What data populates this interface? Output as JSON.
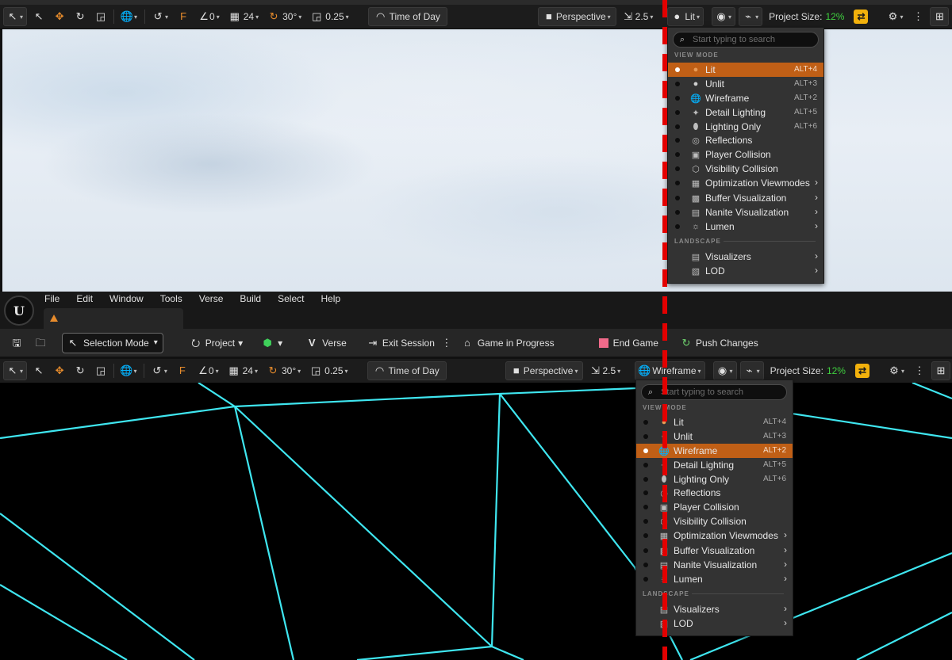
{
  "top_toolbar": {
    "snap_rotate": "0",
    "grid_size": "24",
    "rotate_snap": "30°",
    "scale_snap": "0.25",
    "time_of_day": "Time of Day",
    "perspective": "Perspective",
    "camera_speed": "2.5",
    "view_mode": "Lit",
    "project_size_label": "Project Size:",
    "project_size_value": "12%"
  },
  "bottom_toolbar": {
    "snap_rotate": "0",
    "grid_size": "24",
    "rotate_snap": "30°",
    "scale_snap": "0.25",
    "time_of_day": "Time of Day",
    "perspective": "Perspective",
    "camera_speed": "2.5",
    "view_mode": "Wireframe",
    "project_size_label": "Project Size:",
    "project_size_value": "12%"
  },
  "menu_bar": [
    "File",
    "Edit",
    "Window",
    "Tools",
    "Verse",
    "Build",
    "Select",
    "Help"
  ],
  "main_toolbar": {
    "selection_mode": "Selection Mode",
    "project": "Project",
    "verse": "Verse",
    "exit_session": "Exit Session",
    "game_in_progress": "Game in Progress",
    "end_game": "End Game",
    "push_changes": "Push Changes"
  },
  "view_menu": {
    "search_placeholder": "Start typing to search",
    "section_view_mode": "VIEW MODE",
    "section_landscape": "LANDSCAPE",
    "items": [
      {
        "label": "Lit",
        "shortcut": "ALT+4",
        "icon": "lit-sphere-icon"
      },
      {
        "label": "Unlit",
        "shortcut": "ALT+3",
        "icon": "unlit-sphere-icon"
      },
      {
        "label": "Wireframe",
        "shortcut": "ALT+2",
        "icon": "wireframe-globe-icon"
      },
      {
        "label": "Detail Lighting",
        "shortcut": "ALT+5",
        "icon": "detail-lighting-icon"
      },
      {
        "label": "Lighting Only",
        "shortcut": "ALT+6",
        "icon": "bulb-icon"
      },
      {
        "label": "Reflections",
        "shortcut": "",
        "icon": "reflections-icon"
      },
      {
        "label": "Player Collision",
        "shortcut": "",
        "icon": "player-collision-icon"
      },
      {
        "label": "Visibility Collision",
        "shortcut": "",
        "icon": "visibility-collision-icon"
      },
      {
        "label": "Optimization Viewmodes",
        "shortcut": "",
        "icon": "grid-icon",
        "submenu": true
      },
      {
        "label": "Buffer Visualization",
        "shortcut": "",
        "icon": "buffer-icon",
        "submenu": true
      },
      {
        "label": "Nanite Visualization",
        "shortcut": "",
        "icon": "nanite-icon",
        "submenu": true
      },
      {
        "label": "Lumen",
        "shortcut": "",
        "icon": "lumen-icon",
        "submenu": true
      }
    ],
    "landscape_items": [
      {
        "label": "Visualizers",
        "icon": "visualizers-icon",
        "submenu": true
      },
      {
        "label": "LOD",
        "icon": "lod-icon",
        "submenu": true
      }
    ]
  },
  "colors": {
    "accent": "#e88c2c",
    "selected_row": "#c05f16",
    "project_size_green": "#3fcf3f",
    "wire_cyan": "#3fe6f0",
    "red_marker": "#e30000"
  }
}
